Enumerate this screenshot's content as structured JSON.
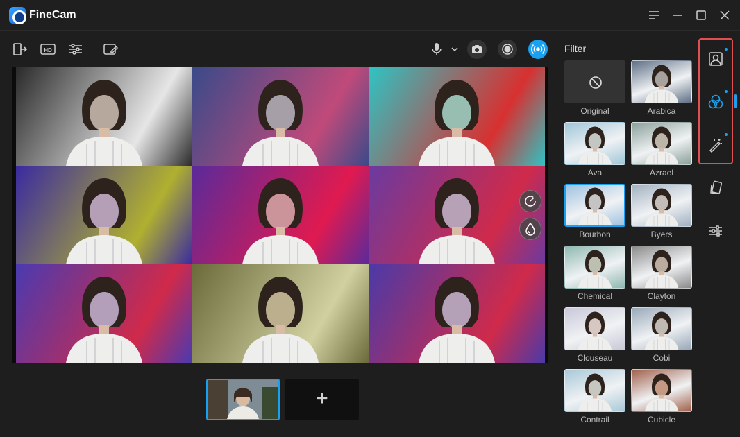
{
  "app": {
    "title": "FineCam"
  },
  "toolbar": {
    "items": [
      "exit-icon",
      "hd-icon",
      "adjust-icon",
      "erase-icon",
      "microphone-icon",
      "chevron-down-icon",
      "camera-icon",
      "record-icon",
      "live-icon"
    ]
  },
  "preview": {
    "cells": [
      {
        "tint": "#808080",
        "bg1": "#2a2a2a",
        "bg2": "#e6e6e6"
      },
      {
        "tint": "#5a6a9a",
        "bg1": "#3a4a8a",
        "bg2": "#c04a7a"
      },
      {
        "tint": "#3ab0b0",
        "bg1": "#2ec4c4",
        "bg2": "#d83030"
      },
      {
        "tint": "#7a6ac0",
        "bg1": "#3a2aa0",
        "bg2": "#b0b030"
      },
      {
        "tint": "#b0507a",
        "bg1": "#5a2a9a",
        "bg2": "#e01a50"
      },
      {
        "tint": "#8070c0",
        "bg1": "#6a3aa0",
        "bg2": "#d02a4a"
      },
      {
        "tint": "#7a6ac8",
        "bg1": "#4a3ab0",
        "bg2": "#d02a4a"
      },
      {
        "tint": "#8a9060",
        "bg1": "#6a6a3a",
        "bg2": "#d0d0a0"
      },
      {
        "tint": "#7a70c0",
        "bg1": "#4a3aa8",
        "bg2": "#d02a4a"
      }
    ],
    "overlay_buttons": [
      "speed-icon",
      "drop-icon"
    ]
  },
  "scenes": {
    "add_label": "+"
  },
  "filter_panel": {
    "title": "Filter",
    "items": [
      {
        "label": "Original",
        "tone": "none"
      },
      {
        "label": "Arabica",
        "tone": "#5e6f85"
      },
      {
        "label": "Ava",
        "tone": "#9fc6d8"
      },
      {
        "label": "Azrael",
        "tone": "#8aa09a"
      },
      {
        "label": "Bourbon",
        "tone": "#9fc2e0"
      },
      {
        "label": "Byers",
        "tone": "#a0b0c0"
      },
      {
        "label": "Chemical",
        "tone": "#8fb8b0"
      },
      {
        "label": "Clayton",
        "tone": "#8a8a8a"
      },
      {
        "label": "Clouseau",
        "tone": "#c8c8d8"
      },
      {
        "label": "Cobi",
        "tone": "#98a8b8"
      },
      {
        "label": "Contrail",
        "tone": "#a8c8d8"
      },
      {
        "label": "Cubicle",
        "tone": "#a0604a"
      }
    ],
    "selected": "Bourbon"
  },
  "sidebar": {
    "items": [
      "portrait-icon",
      "filter-icon",
      "magic-wand-icon",
      "cards-icon",
      "sliders-icon"
    ],
    "active": "filter-icon",
    "accent": "#1aa0f0",
    "highlight": "#e05050"
  }
}
